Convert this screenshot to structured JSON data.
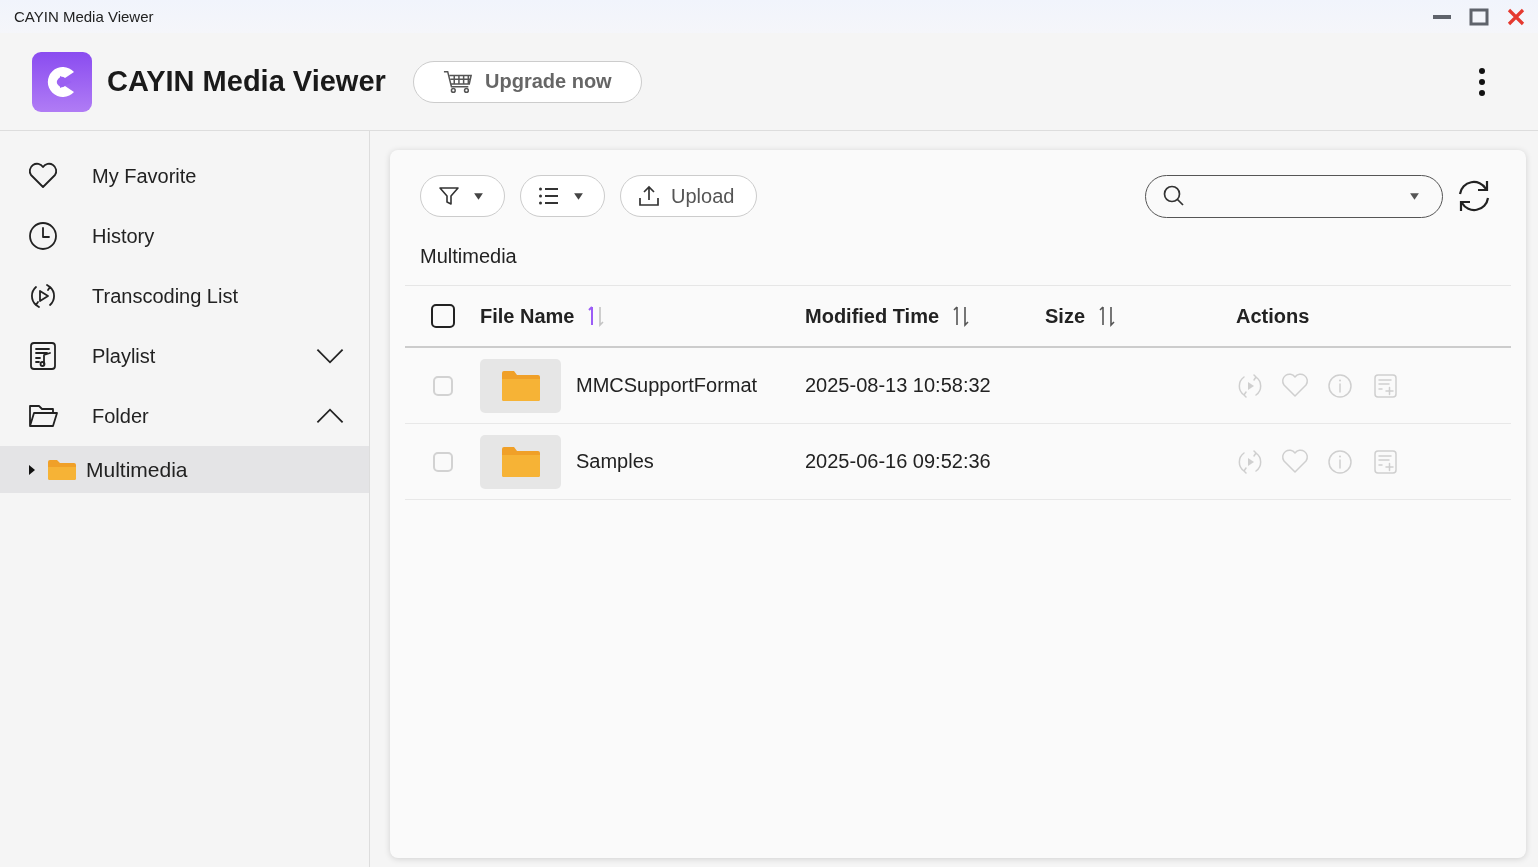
{
  "window": {
    "title": "CAYIN Media Viewer"
  },
  "header": {
    "app_name": "CAYIN Media Viewer",
    "upgrade_button": "Upgrade now"
  },
  "sidebar": {
    "items": [
      {
        "label": "My Favorite",
        "selected": false
      },
      {
        "label": "History",
        "selected": false
      },
      {
        "label": "Transcoding List",
        "selected": false
      },
      {
        "label": "Playlist",
        "selected": false,
        "expanded": false
      },
      {
        "label": "Folder",
        "selected": false,
        "expanded": true,
        "children": [
          {
            "label": "Multimedia",
            "selected": true,
            "expanded": false
          }
        ]
      }
    ]
  },
  "toolbar": {
    "upload_button": "Upload"
  },
  "breadcrumb": "Multimedia",
  "table": {
    "select_all": {
      "checked": false
    },
    "columns": [
      {
        "label": "File Name",
        "sorted": true
      },
      {
        "label": "Modified Time",
        "sorted": false
      },
      {
        "label": "Size",
        "sorted": false
      },
      {
        "label": "Actions"
      }
    ],
    "rows": [
      {
        "name": "MMCSupportFormat",
        "modified": "2025-08-13 10:58:32",
        "checked": false,
        "actions_disabled": true
      },
      {
        "name": "Samples",
        "modified": "2025-06-16 09:52:36",
        "checked": false,
        "actions_disabled": true
      }
    ]
  }
}
